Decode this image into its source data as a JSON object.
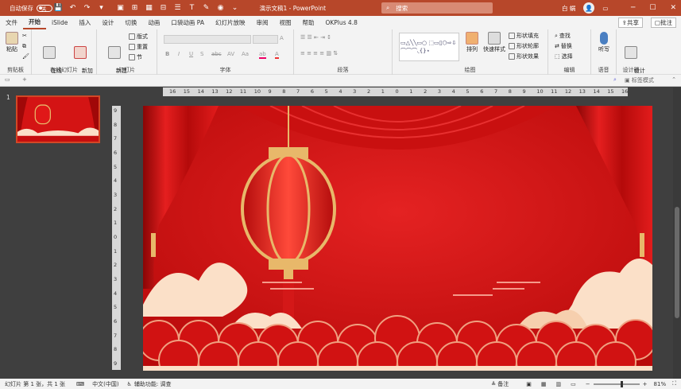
{
  "titlebar": {
    "autosave_label": "自动保存",
    "autosave_state": "关",
    "doc_title": "演示文稿1 - PowerPoint",
    "search_placeholder": "搜索",
    "user_name": "白 蜗",
    "avatar_glyph": "👤",
    "qa_save": "💾",
    "qa_undo": "↶",
    "qa_redo": "↷",
    "qa_more": "▾",
    "min": "─",
    "max": "☐",
    "close": "✕",
    "colors": {
      "bar": "#b7472a"
    }
  },
  "menu": {
    "tabs": [
      "文件",
      "开始",
      "iSlide",
      "插入",
      "设计",
      "切换",
      "动画",
      "口袋动画 PA",
      "幻灯片放映",
      "审阅",
      "视图",
      "帮助",
      "OKPlus 4.8"
    ],
    "active": "开始",
    "share": "共享",
    "comment": "批注"
  },
  "ribbon": {
    "clipboard": {
      "paste": "粘贴",
      "label": "剪贴板"
    },
    "online": {
      "online_slide": "在线\n幻灯片",
      "new_anim": "新加\n动画页",
      "label": "在线幻灯片"
    },
    "slides": {
      "new_slide": "新建\n幻灯片",
      "layout": "版式",
      "reset": "重置",
      "section": "节",
      "label": "幻灯片"
    },
    "font": {
      "bold": "B",
      "italic": "I",
      "underline": "U",
      "shadow": "S",
      "strike": "abc",
      "spacing": "AV",
      "case": "Aa",
      "color": "A",
      "label": "字体"
    },
    "paragraph": {
      "label": "段落"
    },
    "drawing": {
      "arrange": "排列",
      "quick_styles": "快速样式",
      "shape_fill": "形状填充",
      "shape_outline": "形状轮廓",
      "shape_effect": "形状效果",
      "label": "绘图"
    },
    "editing": {
      "find": "查找",
      "replace": "替换",
      "select": "选择",
      "label": "编辑"
    },
    "voice": {
      "dictate": "听写",
      "label": "语音"
    },
    "designer": {
      "ideas": "设计\n灵感",
      "label": "设计器"
    }
  },
  "subbar": {
    "tag_mode": "标签模式"
  },
  "slides_pane": {
    "number": "1"
  },
  "hruler": [
    "16",
    "15",
    "14",
    "13",
    "12",
    "11",
    "10",
    "9",
    "8",
    "7",
    "6",
    "5",
    "4",
    "3",
    "2",
    "1",
    "0",
    "1",
    "2",
    "3",
    "4",
    "5",
    "6",
    "7",
    "8",
    "9",
    "10",
    "11",
    "12",
    "13",
    "14",
    "15",
    "16"
  ],
  "vruler": [
    "9",
    "8",
    "7",
    "6",
    "5",
    "4",
    "3",
    "2",
    "1",
    "0",
    "1",
    "2",
    "3",
    "4",
    "5",
    "6",
    "7",
    "8",
    "9"
  ],
  "status": {
    "slide_info": "幻灯片 第 1 张，共 1 张",
    "language": "中文(中国)",
    "accessibility": "辅助功能: 调查",
    "notes": "备注",
    "zoom": "81%"
  },
  "slide_colors": {
    "bg": "#d41414",
    "curtain": "#c40d0d",
    "gold": "#e8b86a",
    "cloud": "#fbe0c8"
  }
}
